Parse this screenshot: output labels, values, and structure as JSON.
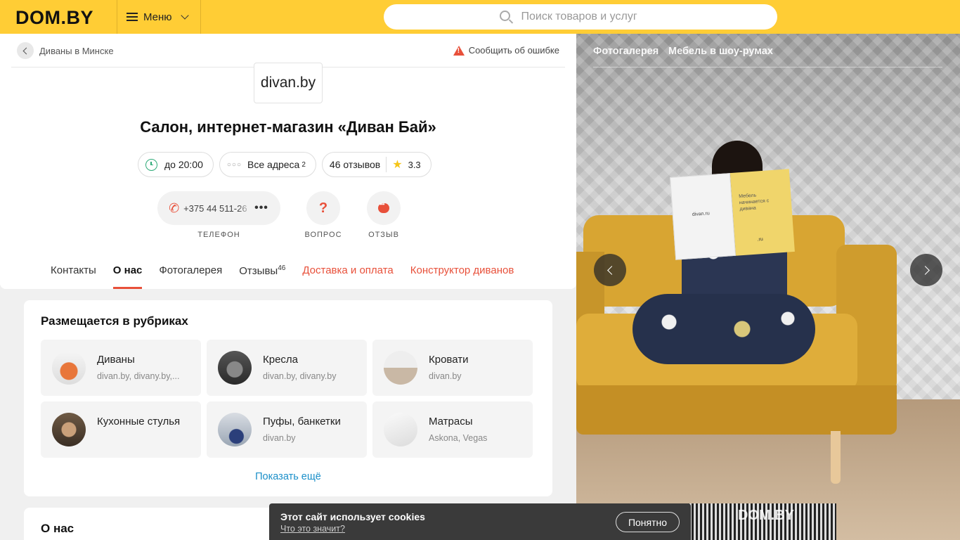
{
  "header": {
    "logo": "DOM.BY",
    "menu_label": "Меню",
    "search_placeholder": "Поиск товаров и услуг"
  },
  "breadcrumb": {
    "label": "Диваны в Минске"
  },
  "report": {
    "label": "Сообщить об ошибке"
  },
  "company": {
    "logo_text": "divan.by",
    "title": "Салон, интернет-магазин «Диван Бай»"
  },
  "chips": {
    "hours": "до 20:00",
    "addresses": "Все адреса",
    "addresses_count": "2",
    "reviews": "46 отзывов",
    "rating": "3.3"
  },
  "actions": {
    "phone": "+375 44 511-26",
    "phone_label": "ТЕЛЕФОН",
    "question_label": "ВОПРОС",
    "review_label": "ОТЗЫВ"
  },
  "tabs": {
    "contacts": "Контакты",
    "about": "О нас",
    "gallery": "Фотогалерея",
    "reviews": "Отзывы",
    "reviews_count": "46",
    "delivery": "Доставка и оплата",
    "constructor": "Конструктор диванов"
  },
  "rubrics": {
    "title": "Размещается в рубриках",
    "items": [
      {
        "name": "Диваны",
        "sub": "divan.by, divany.by,..."
      },
      {
        "name": "Кресла",
        "sub": "divan.by, divany.by"
      },
      {
        "name": "Кровати",
        "sub": "divan.by"
      },
      {
        "name": "Кухонные стулья",
        "sub": ""
      },
      {
        "name": "Пуфы, банкетки",
        "sub": "divan.by"
      },
      {
        "name": "Матрасы",
        "sub": "Askona, Vegas"
      }
    ],
    "show_more": "Показать ещё"
  },
  "about": {
    "title": "О нас"
  },
  "photo": {
    "tab_gallery": "Фотогалерея",
    "tab_showrooms": "Мебель в шоу-румах",
    "book_left": "divan.ru",
    "book_right": "Мебель начинается с дивана",
    "book_brand": ".ru",
    "watermark": "DOM.BY"
  },
  "cookie": {
    "title": "Этот сайт использует cookies",
    "link": "Что это значит?",
    "button": "Понятно"
  },
  "colors": {
    "brand_yellow": "#ffcd35",
    "accent_red": "#e8503a",
    "link_blue": "#1a8fc9",
    "clock_green": "#2eaa78"
  }
}
